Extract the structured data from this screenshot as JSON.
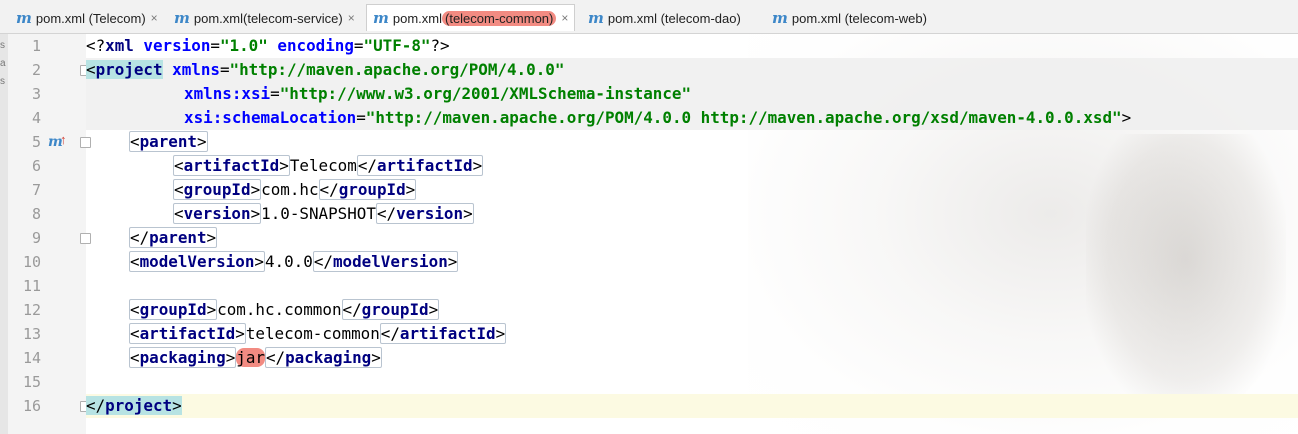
{
  "tabs": [
    {
      "icon": "m",
      "label": "pom.xml (Telecom)",
      "close": "×"
    },
    {
      "icon": "m",
      "label_prefix": "pom.xml ",
      "label": "(telecom-service)",
      "close": "×"
    },
    {
      "icon": "m",
      "label_prefix": "pom.xml ",
      "label": "(telecom-common)",
      "close": "×"
    },
    {
      "icon": "m",
      "label": "pom.xml (telecom-dao)"
    },
    {
      "icon": "m",
      "label": "pom.xml (telecom-web)"
    }
  ],
  "gutter": {
    "line_numbers": [
      "1",
      "2",
      "3",
      "4",
      "5",
      "6",
      "7",
      "8",
      "9",
      "10",
      "11",
      "12",
      "13",
      "14",
      "15",
      "16"
    ],
    "maven_marker": "m",
    "maven_arrow": "↑"
  },
  "edge_chars": [
    "s",
    "a",
    "s"
  ],
  "code": {
    "l1": {
      "p1": "<?",
      "tag": "xml",
      "a1": " version",
      "eq1": "=",
      "v1": "\"1.0\"",
      "a2": " encoding",
      "eq2": "=",
      "v2": "\"UTF-8\"",
      "p2": "?>"
    },
    "l2": {
      "open": "<",
      "tag": "project",
      "attr": " xmlns",
      "eq": "=",
      "val": "\"http://maven.apache.org/POM/4.0.0\""
    },
    "l3": {
      "attr": "xmlns:xsi",
      "eq": "=",
      "val": "\"http://www.w3.org/2001/XMLSchema-instance\""
    },
    "l4": {
      "attr": "xsi:schemaLocation",
      "eq": "=",
      "val": "\"http://maven.apache.org/POM/4.0.0 http://maven.apache.org/xsd/maven-4.0.0.xsd\"",
      "close": ">"
    },
    "l5": {
      "tag": "parent"
    },
    "l6": {
      "tag": "artifactId",
      "text": "Telecom"
    },
    "l7": {
      "tag": "groupId",
      "text": "com.hc"
    },
    "l8": {
      "tag": "version",
      "text": "1.0-SNAPSHOT"
    },
    "l9": {
      "tag": "parent"
    },
    "l10": {
      "tag": "modelVersion",
      "text": "4.0.0"
    },
    "l12": {
      "tag": "groupId",
      "text": "com.hc.common"
    },
    "l13": {
      "tag": "artifactId",
      "text": "telecom-common"
    },
    "l14": {
      "tag": "packaging",
      "text": "jar"
    },
    "l16": {
      "tag": "project"
    }
  }
}
